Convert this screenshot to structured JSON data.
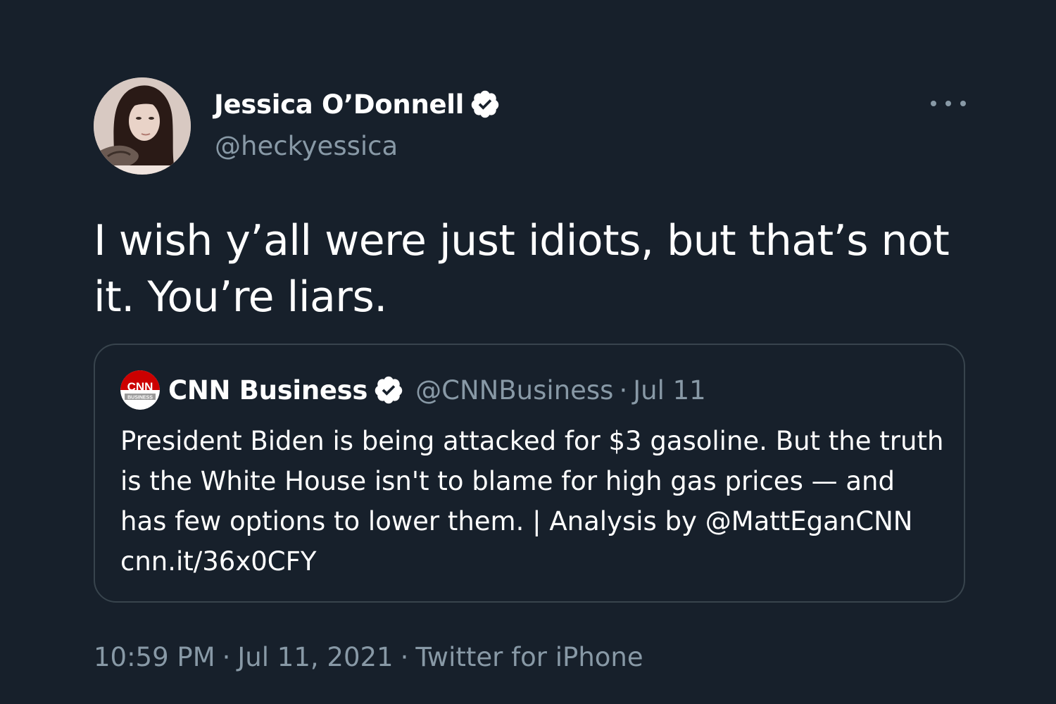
{
  "author": {
    "name": "Jessica O’Donnell",
    "handle": "@heckyessica",
    "verified": true
  },
  "tweet": {
    "text": "I wish y’all were just idiots, but that’s not it. You’re liars."
  },
  "quoted_tweet": {
    "name": "CNN Business",
    "handle": "@CNNBusiness",
    "separator": "·",
    "date": "Jul 11",
    "verified": true,
    "logo": "CNN",
    "logo_sub": "BUSINESS",
    "text": "President Biden is being attacked for $3 gasoline. But the truth is the White House isn't to blame for high gas prices — and has few options to lower them. | Analysis by @MattEganCNN cnn.it/36x0CFY"
  },
  "meta": {
    "time": "10:59 PM",
    "date": "Jul 11, 2021",
    "source": "Twitter for iPhone",
    "separator": "·"
  },
  "icons": {
    "more": "more-dots-icon",
    "verified": "verified-badge-icon"
  },
  "colors": {
    "background": "#17202b",
    "secondary_text": "#8899a6",
    "border": "#38444d",
    "cnn_red": "#cc0000"
  }
}
